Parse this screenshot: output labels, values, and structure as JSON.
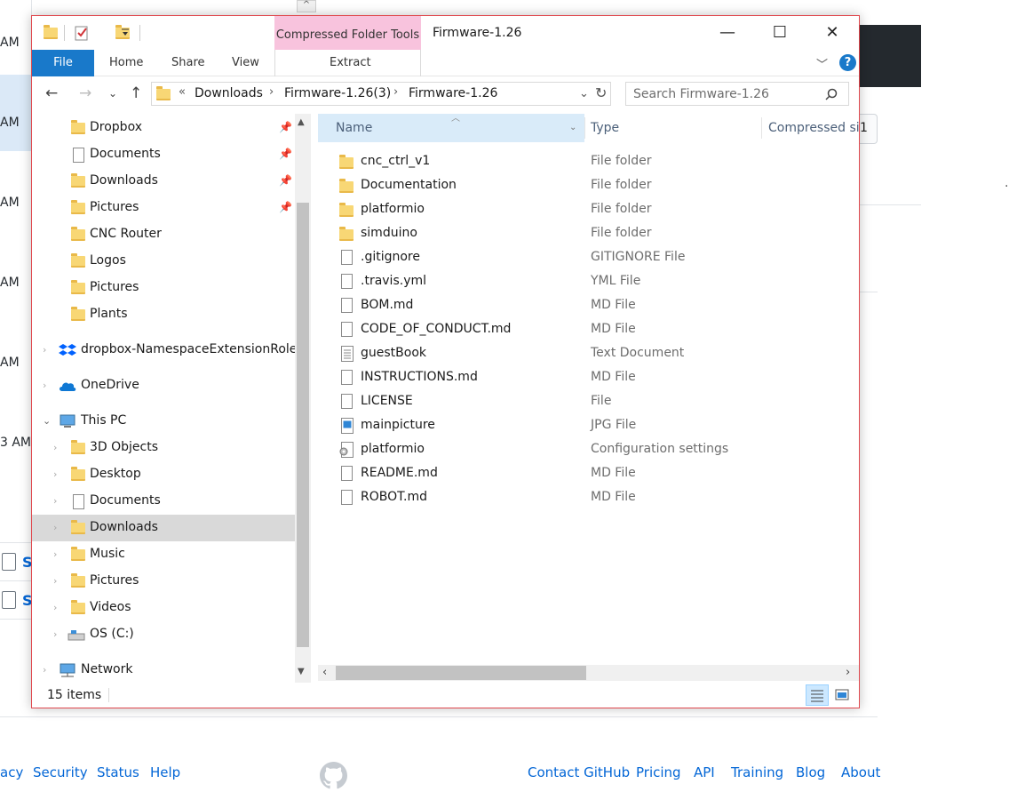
{
  "background": {
    "times": [
      "AM",
      "AM",
      "AM",
      "AM",
      "AM",
      "3 AM"
    ],
    "partial_button": "1",
    "scroll_arrow": "^",
    "partial_letters": [
      "S",
      "S"
    ],
    "right_mark": "·"
  },
  "footer": {
    "links_left": [
      "acy",
      "Security",
      "Status",
      "Help"
    ],
    "links_right": [
      "Contact GitHub",
      "Pricing",
      "API",
      "Training",
      "Blog",
      "About"
    ]
  },
  "window": {
    "title": "Firmware-1.26",
    "context_tab": "Compressed Folder Tools",
    "ribbon_tabs": {
      "file": "File",
      "home": "Home",
      "share": "Share",
      "view": "View",
      "extract": "Extract"
    },
    "controls": {
      "minimize": "—",
      "maximize": "☐",
      "close": "✕"
    },
    "help": "?"
  },
  "address": {
    "overflow": "«",
    "crumbs": [
      "Downloads",
      "Firmware-1.26(3)",
      "Firmware-1.26"
    ]
  },
  "search": {
    "placeholder": "Search Firmware-1.26"
  },
  "navpane": {
    "items": [
      {
        "label": "Dropbox",
        "icon": "dropbox-folder-icon",
        "pinned": true
      },
      {
        "label": "Documents",
        "icon": "documents-folder-icon",
        "pinned": true
      },
      {
        "label": "Downloads",
        "icon": "downloads-folder-icon",
        "pinned": true
      },
      {
        "label": "Pictures",
        "icon": "pictures-folder-icon",
        "pinned": true
      },
      {
        "label": "CNC Router",
        "icon": "folder-icon",
        "pinned": false
      },
      {
        "label": "Logos",
        "icon": "folder-icon",
        "pinned": false
      },
      {
        "label": "Pictures",
        "icon": "folder-icon",
        "pinned": false
      },
      {
        "label": "Plants",
        "icon": "folder-icon",
        "pinned": false
      },
      {
        "label": "dropbox-NamespaceExtensionRole.l",
        "icon": "dropbox-icon",
        "pinned": false
      },
      {
        "label": "OneDrive",
        "icon": "onedrive-icon",
        "pinned": false
      },
      {
        "label": "This PC",
        "icon": "this-pc-icon",
        "pinned": false
      },
      {
        "label": "3D Objects",
        "icon": "3d-objects-icon",
        "pinned": false
      },
      {
        "label": "Desktop",
        "icon": "desktop-icon",
        "pinned": false
      },
      {
        "label": "Documents",
        "icon": "documents-folder-icon",
        "pinned": false
      },
      {
        "label": "Downloads",
        "icon": "downloads-folder-icon",
        "pinned": false
      },
      {
        "label": "Music",
        "icon": "music-folder-icon",
        "pinned": false
      },
      {
        "label": "Pictures",
        "icon": "pictures-folder-icon",
        "pinned": false
      },
      {
        "label": "Videos",
        "icon": "videos-folder-icon",
        "pinned": false
      },
      {
        "label": "OS (C:)",
        "icon": "drive-icon",
        "pinned": false
      },
      {
        "label": "Network",
        "icon": "network-icon",
        "pinned": false
      }
    ]
  },
  "columns": {
    "name": "Name",
    "type": "Type",
    "compressed_size": "Compressed siz"
  },
  "files": [
    {
      "name": "cnc_ctrl_v1",
      "type": "File folder",
      "kind": "folder"
    },
    {
      "name": "Documentation",
      "type": "File folder",
      "kind": "folder"
    },
    {
      "name": "platformio",
      "type": "File folder",
      "kind": "folder"
    },
    {
      "name": "simduino",
      "type": "File folder",
      "kind": "folder"
    },
    {
      "name": ".gitignore",
      "type": "GITIGNORE File",
      "kind": "file"
    },
    {
      "name": ".travis.yml",
      "type": "YML File",
      "kind": "file"
    },
    {
      "name": "BOM.md",
      "type": "MD File",
      "kind": "file"
    },
    {
      "name": "CODE_OF_CONDUCT.md",
      "type": "MD File",
      "kind": "file"
    },
    {
      "name": "guestBook",
      "type": "Text Document",
      "kind": "text"
    },
    {
      "name": "INSTRUCTIONS.md",
      "type": "MD File",
      "kind": "file"
    },
    {
      "name": "LICENSE",
      "type": "File",
      "kind": "file"
    },
    {
      "name": "mainpicture",
      "type": "JPG File",
      "kind": "image"
    },
    {
      "name": "platformio",
      "type": "Configuration settings",
      "kind": "config"
    },
    {
      "name": "README.md",
      "type": "MD File",
      "kind": "file"
    },
    {
      "name": "ROBOT.md",
      "type": "MD File",
      "kind": "file"
    }
  ],
  "status": {
    "item_count": "15 items"
  }
}
